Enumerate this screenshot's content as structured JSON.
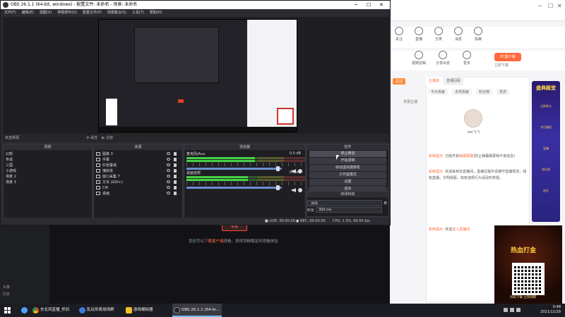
{
  "obs": {
    "title": "OBS 26.1.1 (64-bit, windows) - 配置文件: 未命名 - 场景: 未命名",
    "menu": [
      "文件(F)",
      "编辑(E)",
      "视图(V)",
      "停靠部件(D)",
      "配置文件(P)",
      "场景集合(S)",
      "工具(T)",
      "帮助(H)"
    ],
    "no_source_label": "未选择源",
    "properties_label": "属性",
    "filters_label": "滤镜",
    "scenes": {
      "title": "场景",
      "items": [
        "幻想",
        "传说",
        "三国",
        "小游戏",
        "场景 2",
        "场景 3"
      ]
    },
    "sources": {
      "title": "来源",
      "items": [
        "图像 3",
        "字幕",
        "红色警戒",
        "捕获进",
        "窗口采集 7",
        "文本 (GDI+)",
        "CM",
        "桌面"
      ]
    },
    "mixer": {
      "title": "混音器",
      "channels": [
        {
          "name": "麦克风/Aux",
          "db": "0.0 dB",
          "level": 0.58,
          "fader": 0.98
        },
        {
          "name": "桌面音频",
          "db": "0.0 dB",
          "level": 0.52,
          "fader": 0.98
        }
      ]
    },
    "controls": {
      "title": "控件",
      "buttons": [
        "停止推流",
        "开始录制",
        "启动虚拟摄像机",
        "工作室模式",
        "设置",
        "退出"
      ]
    },
    "transitions": {
      "title": "转场特效",
      "selected": "淡出",
      "duration_label": "时长",
      "duration_value": "300 ms"
    },
    "status": {
      "live_label": "LIVE:",
      "live_time": "00:00:00",
      "rec_label": "REC:",
      "rec_time": "00:00:00",
      "cpu": "CPU: 1.3%, 60.00 fps"
    }
  },
  "browser": {
    "nav_items": [
      "关注",
      "直播",
      "分类",
      "消息",
      "投稿"
    ],
    "nav2_items": [
      "视频剪辑",
      "分享出去",
      "更多"
    ],
    "pc_button": "PC客户端",
    "download_label": "立即下载",
    "report_button": "举报",
    "notice_prefix": "您还可以",
    "notice_highlight": "下载客户端",
    "notice_suffix": "观看，获得流畅稳定的观看体验",
    "chat_tabs": [
      "主播说",
      "直播回看"
    ],
    "sub_tabs": [
      "今日贡献",
      "本周贡献",
      "粉丝榜",
      "贵宾"
    ],
    "follow_button": "关注",
    "report_link": "举报主播",
    "anchor_name": "lee飞飞",
    "messages": [
      {
        "tag": "系统提示:",
        "text": "已经开启",
        "hl": "弹幕屏蔽",
        "rest": "(防止弹幕刷屏和不良信息)"
      },
      {
        "tag": "系统提示:",
        "text": "欢迎来到本直播间，直播过程中请遵守直播规范，绿色直播，文明观看。如有违规行为请及时举报。"
      },
      {
        "tag": "系统提示:",
        "text": "欢迎",
        "hl": "进入直播间",
        "rest": ""
      }
    ],
    "promo": {
      "title": "盛典殿堂",
      "items": [
        "立即参与",
        "今日福利",
        "宝箱",
        "排行榜",
        "送礼"
      ]
    },
    "game_ad": {
      "title": "热血打金",
      "caption": "扫码下载 立刻领取"
    },
    "sidebar_labels": [
      "头像",
      "历史"
    ]
  },
  "taskbar": {
    "apps": [
      {
        "label": "东北风直播_怀旧",
        "color": "#e8eaed"
      },
      {
        "label": "乱玩传奇战场群",
        "color": "#3c7bd9"
      },
      {
        "label": "游戏模拟器",
        "color": "#f2c227"
      },
      {
        "label": "OBS 26.1.1 (64-bi...",
        "color": "#111111"
      }
    ],
    "time": "0:48",
    "date": "2021/11/29"
  }
}
